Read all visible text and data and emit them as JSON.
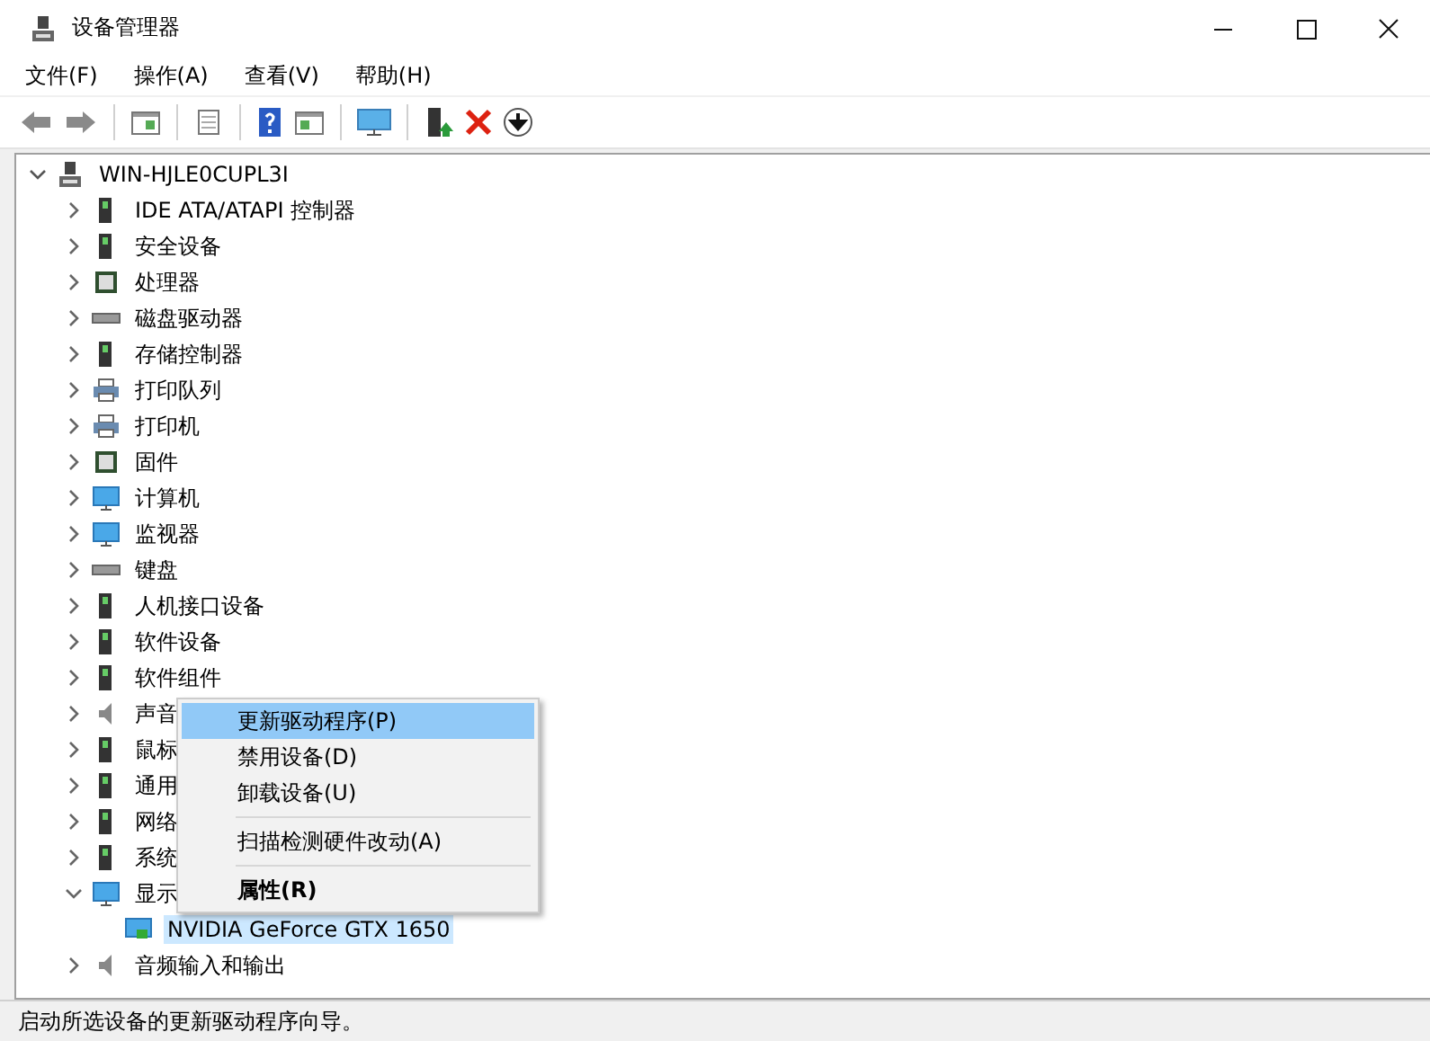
{
  "window": {
    "title": "设备管理器"
  },
  "menu_bar": [
    "文件(F)",
    "操作(A)",
    "查看(V)",
    "帮助(H)"
  ],
  "tree": {
    "label": "WIN-HJLE0CUPL3I",
    "expanded": true,
    "children": [
      {
        "label": "IDE ATA/ATAPI 控制器",
        "expanded": false
      },
      {
        "label": "安全设备",
        "expanded": false
      },
      {
        "label": "处理器",
        "expanded": false
      },
      {
        "label": "磁盘驱动器",
        "expanded": false
      },
      {
        "label": "存储控制器",
        "expanded": false
      },
      {
        "label": "打印队列",
        "expanded": false
      },
      {
        "label": "打印机",
        "expanded": false
      },
      {
        "label": "固件",
        "expanded": false
      },
      {
        "label": "计算机",
        "expanded": false
      },
      {
        "label": "监视器",
        "expanded": false
      },
      {
        "label": "键盘",
        "expanded": false
      },
      {
        "label": "人机接口设备",
        "expanded": false
      },
      {
        "label": "软件设备",
        "expanded": false
      },
      {
        "label": "软件组件",
        "expanded": false
      },
      {
        "label": "声音",
        "expanded": false
      },
      {
        "label": "鼠标",
        "expanded": false
      },
      {
        "label": "通用",
        "expanded": false
      },
      {
        "label": "网络",
        "expanded": false
      },
      {
        "label": "系统",
        "expanded": false
      },
      {
        "label": "显示",
        "expanded": true,
        "children": [
          {
            "label": "NVIDIA GeForce GTX 1650",
            "selected": true
          }
        ]
      },
      {
        "label": "音频输入和输出",
        "expanded": false
      }
    ]
  },
  "context_menu": [
    {
      "label": "更新驱动程序(P)",
      "selected": true,
      "separator_before": false,
      "default": false
    },
    {
      "label": "禁用设备(D)",
      "selected": false,
      "separator_before": false,
      "default": false
    },
    {
      "label": "卸载设备(U)",
      "selected": false,
      "separator_before": false,
      "default": false
    },
    {
      "label": "扫描检测硬件改动(A)",
      "selected": false,
      "separator_before": true,
      "default": false
    },
    {
      "label": "属性(R)",
      "selected": false,
      "separator_before": true,
      "default": true
    }
  ],
  "status_bar": "启动所选设备的更新驱动程序向导。"
}
